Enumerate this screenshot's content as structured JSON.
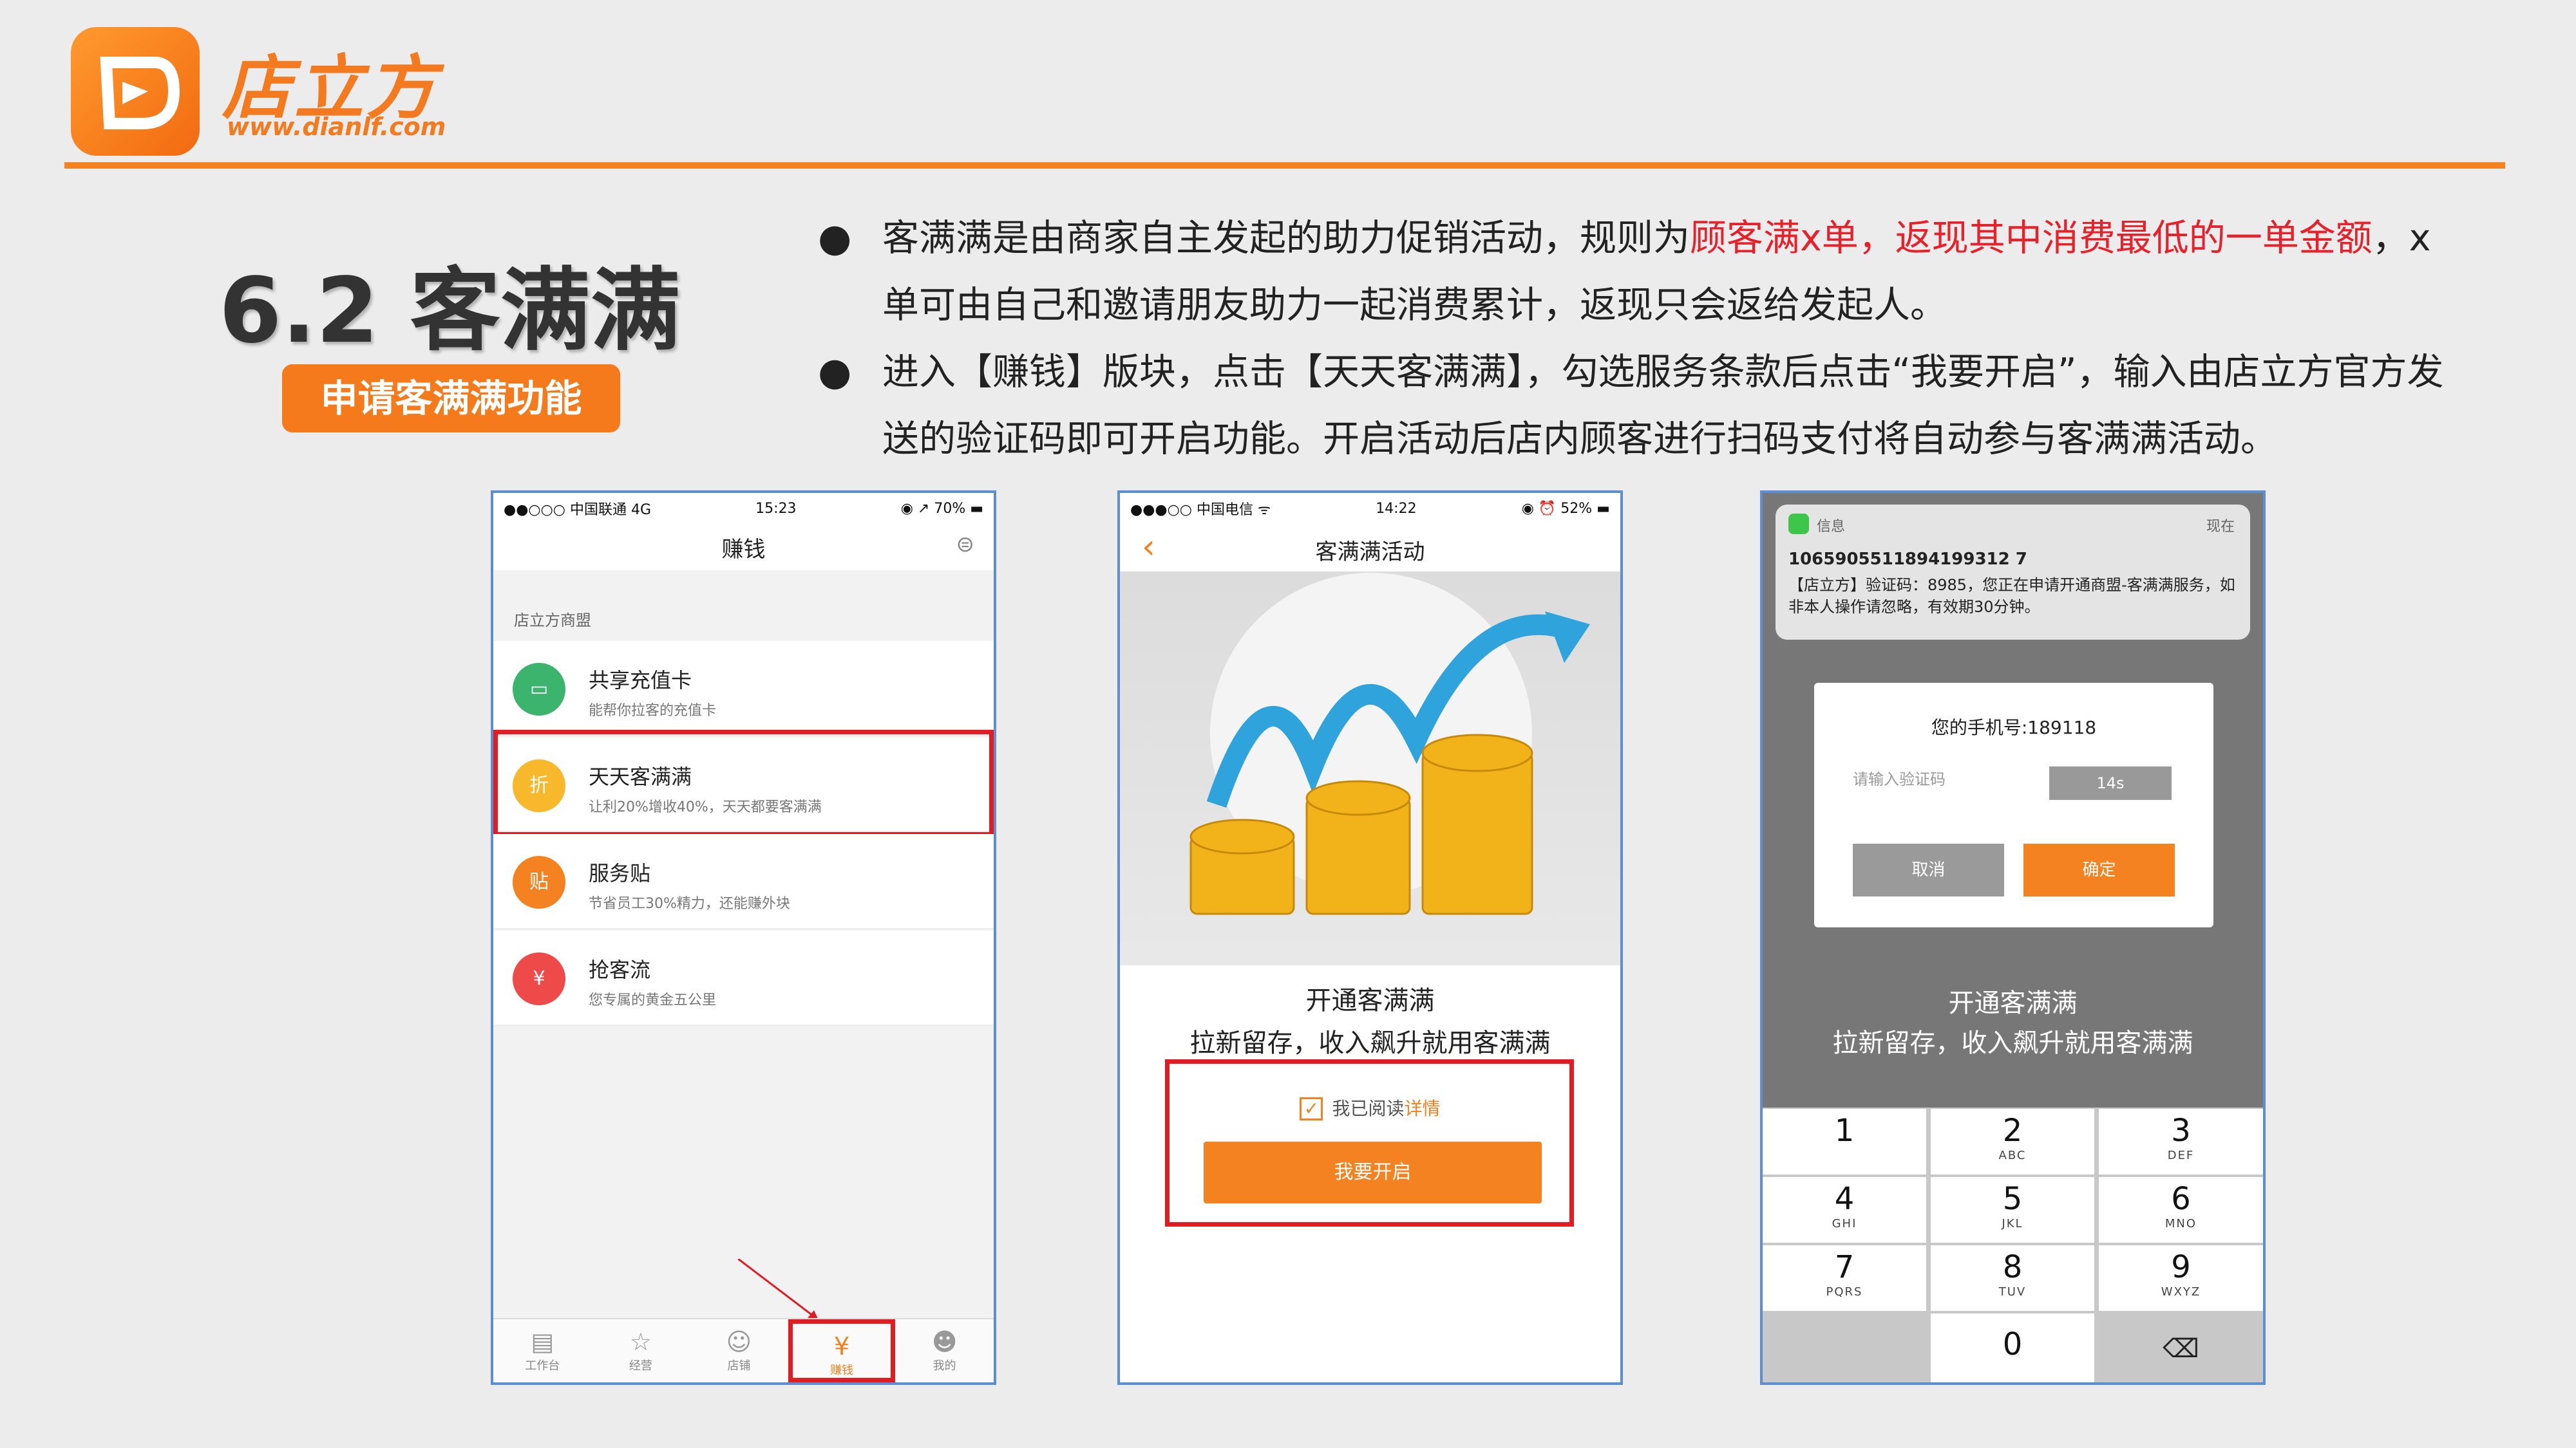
{
  "header": {
    "brand": "店立方",
    "url": "www.dianlf.com"
  },
  "section": {
    "title": "6.2 客满满",
    "badge": "申请客满满功能"
  },
  "bullets": [
    {
      "p1": "客满满是由商家自主发起的助力促销活动，规则为",
      "p2": "顾客满x单，返现其中消费最低的一单金额",
      "p3": "，x单可由自己和邀请朋友助力一起消费累计，返现只会返给发起人。"
    },
    {
      "text": "进入【赚钱】版块，点击【天天客满满】，勾选服务条款后点击“我要开启”，输入由店立方官方发送的验证码即可开启功能。开启活动后店内顾客进行扫码支付将自动参与客满满活动。"
    }
  ],
  "phone1": {
    "status": {
      "carrier": "●●○○○ 中国联通 4G",
      "time": "15:23",
      "battery": "◉ ↗ 70% ▬"
    },
    "title": "赚钱",
    "group": "店立方商盟",
    "items": [
      {
        "title": "共享充值卡",
        "sub": "能帮你拉客的充值卡",
        "icon": "card-icon",
        "glyph": "▭",
        "color": "#3cb46e"
      },
      {
        "title": "天天客满满",
        "sub": "让利20%增收40%，天天都要客满满",
        "icon": "discount-icon",
        "glyph": "折",
        "color": "#f7b82b"
      },
      {
        "title": "服务贴",
        "sub": "节省员工30%精力，还能赚外块",
        "icon": "sticker-icon",
        "glyph": "贴",
        "color": "#f58220"
      },
      {
        "title": "抢客流",
        "sub": "您专属的黄金五公里",
        "icon": "ticket-icon",
        "glyph": "¥",
        "color": "#ef4a4a"
      }
    ],
    "tabs": [
      {
        "label": "工作台",
        "glyph": "▤"
      },
      {
        "label": "经营",
        "glyph": "☆"
      },
      {
        "label": "店铺",
        "glyph": "☺"
      },
      {
        "label": "赚钱",
        "glyph": "¥"
      },
      {
        "label": "我的",
        "glyph": "☻"
      }
    ]
  },
  "phone2": {
    "status": {
      "carrier": "●●●○○ 中国电信 ᯤ",
      "time": "14:22",
      "battery": "◉ ⏰ 52% ▬"
    },
    "back": "‹",
    "title": "客满满活动",
    "headline": "开通客满满",
    "subline": "拉新留存，收入飙升就用客满满",
    "agree_prefix": "我已阅读",
    "agree_link": "详情",
    "check": "✓",
    "button": "我要开启"
  },
  "phone3": {
    "notice": {
      "app": "信息",
      "time": "现在",
      "sender": "1065905511894199312 7",
      "body": "【店立方】验证码：8985，您正在申请开通商盟-客满满服务，如非本人操作请忽略，有效期30分钟。"
    },
    "dialog": {
      "phone_label": "您的手机号:189118",
      "placeholder": "请输入验证码",
      "countdown": "14s",
      "cancel": "取消",
      "confirm": "确定"
    },
    "headline": "开通客满满",
    "subline": "拉新留存，收入飙升就用客满满",
    "keys": [
      [
        "1",
        ""
      ],
      [
        "2",
        "ABC"
      ],
      [
        "3",
        "DEF"
      ],
      [
        "4",
        "GHI"
      ],
      [
        "5",
        "JKL"
      ],
      [
        "6",
        "MNO"
      ],
      [
        "7",
        "PQRS"
      ],
      [
        "8",
        "TUV"
      ],
      [
        "9",
        "WXYZ"
      ],
      [
        "0",
        ""
      ]
    ],
    "backspace": "⌫"
  },
  "colors": {
    "accent": "#f58220",
    "highlight": "#e8202a",
    "phone_border": "#5b8fd1"
  }
}
